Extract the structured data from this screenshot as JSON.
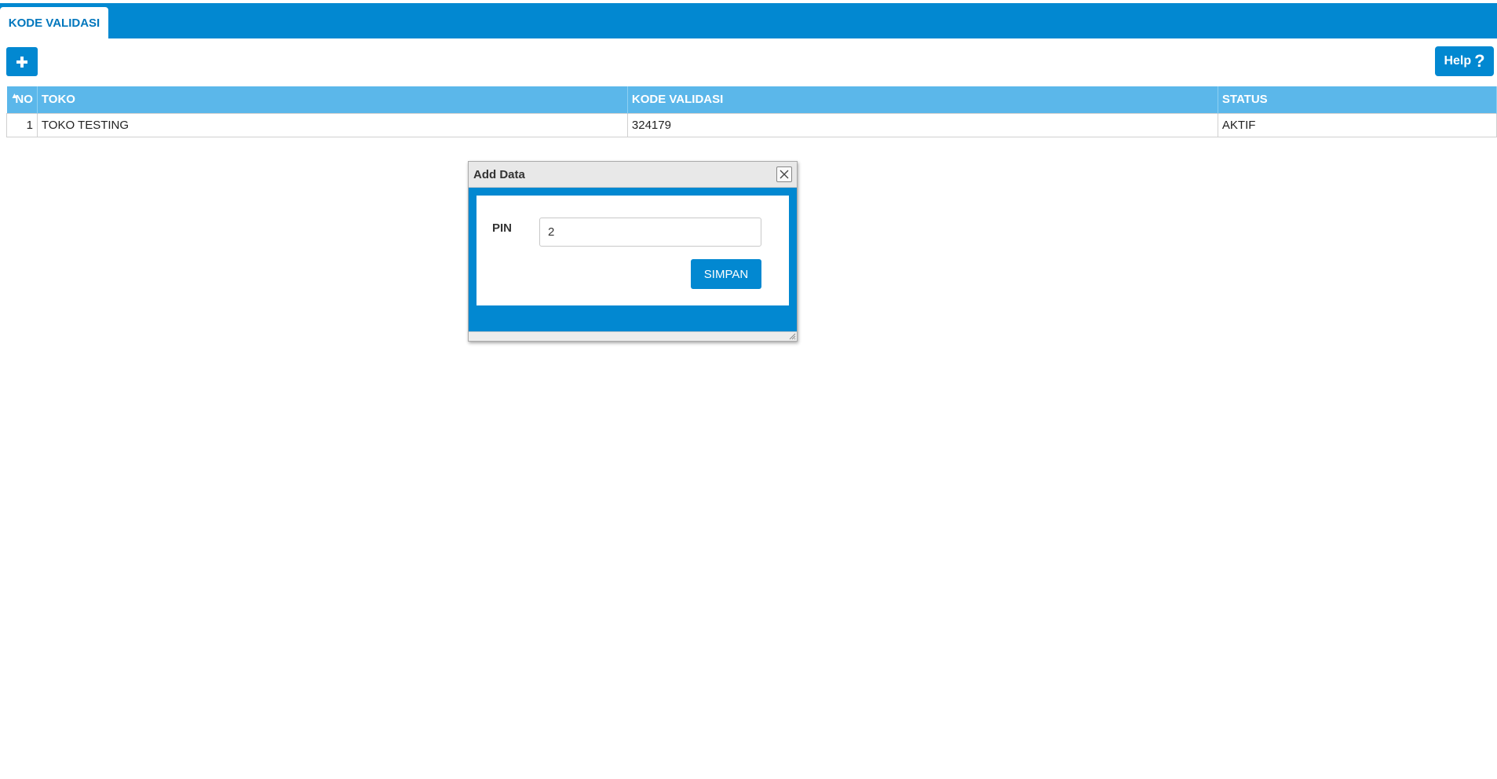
{
  "app": {
    "tab_label": "KODE VALIDASI"
  },
  "toolbar": {
    "add_icon": "plus-icon",
    "help_label": "Help",
    "help_icon": "question-icon"
  },
  "table": {
    "columns": [
      "NO",
      "TOKO",
      "KODE VALIDASI",
      "STATUS"
    ],
    "rows": [
      {
        "no": "1",
        "toko": "TOKO TESTING",
        "kode": "324179",
        "status": "AKTIF"
      }
    ]
  },
  "dialog": {
    "title": "Add Data",
    "pin_label": "PIN",
    "pin_value": "2",
    "save_label": "SIMPAN"
  },
  "colors": {
    "primary": "#0288d1",
    "table_header": "#5bb7ea"
  }
}
